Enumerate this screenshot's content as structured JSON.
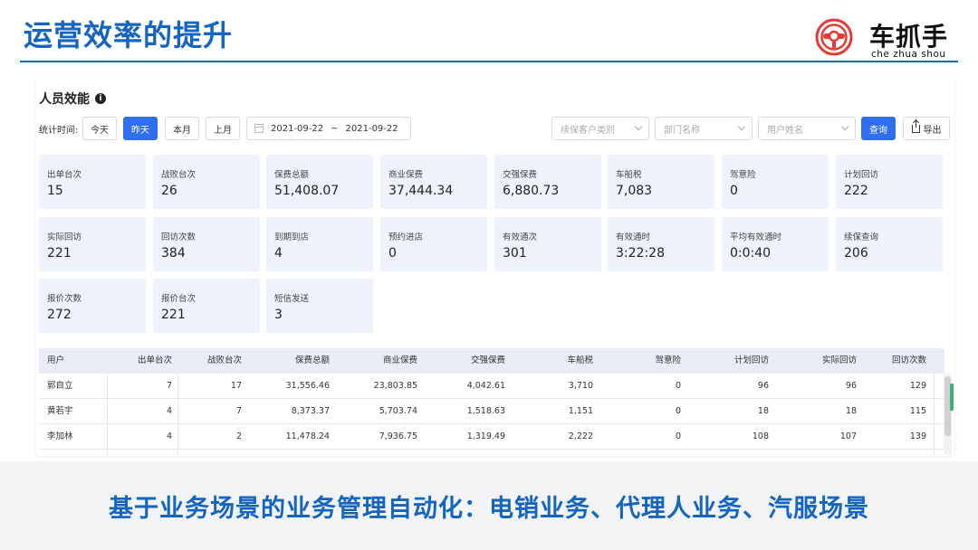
{
  "slide": {
    "title": "运营效率的提升",
    "footer": "基于业务场景的业务管理自动化：电销业务、代理人业务、汽服场景"
  },
  "logo": {
    "name_cn": "车抓手",
    "name_en": "che zhua shou",
    "brand_color": "#e53935"
  },
  "panel": {
    "title": "人员效能",
    "filters": {
      "stat_time_label": "统计时间:",
      "quick_ranges": [
        "今天",
        "昨天",
        "本月",
        "上月"
      ],
      "selected_range": "昨天",
      "date_start": "2021-09-22",
      "date_sep": "~",
      "date_end": "2021-09-22",
      "renewal_category_placeholder": "续保客户类别",
      "department_placeholder": "部门名称",
      "user_name_placeholder": "用户姓名",
      "query_label": "查询",
      "export_label": "导出"
    },
    "metrics": [
      {
        "label": "出单台次",
        "value": "15"
      },
      {
        "label": "战败台次",
        "value": "26"
      },
      {
        "label": "保费总额",
        "value": "51,408.07"
      },
      {
        "label": "商业保费",
        "value": "37,444.34"
      },
      {
        "label": "交强保费",
        "value": "6,880.73"
      },
      {
        "label": "车船税",
        "value": "7,083"
      },
      {
        "label": "驾意险",
        "value": "0"
      },
      {
        "label": "计划回访",
        "value": "222"
      },
      {
        "label": "实际回访",
        "value": "221"
      },
      {
        "label": "回访次数",
        "value": "384"
      },
      {
        "label": "到期到店",
        "value": "4"
      },
      {
        "label": "预约进店",
        "value": "0"
      },
      {
        "label": "有效通次",
        "value": "301"
      },
      {
        "label": "有效通时",
        "value": "3:22:28"
      },
      {
        "label": "平均有效通时",
        "value": "0:0:40"
      },
      {
        "label": "续保查询",
        "value": "206"
      },
      {
        "label": "报价次数",
        "value": "272"
      },
      {
        "label": "报价台次",
        "value": "221"
      },
      {
        "label": "短信发送",
        "value": "3"
      }
    ],
    "table": {
      "columns": [
        "用户",
        "出单台次",
        "战败台次",
        "保费总额",
        "商业保费",
        "交强保费",
        "车船税",
        "驾意险",
        "计划回访",
        "实际回访",
        "回访次数"
      ],
      "rows": [
        [
          "郭自立",
          "7",
          "17",
          "31,556.46",
          "23,803.85",
          "4,042.61",
          "3,710",
          "0",
          "96",
          "96",
          "129"
        ],
        [
          "黄若宇",
          "4",
          "7",
          "8,373.37",
          "5,703.74",
          "1,518.63",
          "1,151",
          "0",
          "18",
          "18",
          "115"
        ],
        [
          "李加林",
          "4",
          "2",
          "11,478.24",
          "7,936.75",
          "1,319.49",
          "2,222",
          "0",
          "108",
          "107",
          "139"
        ]
      ]
    }
  },
  "colors": {
    "title_blue": "#1565c0",
    "primary_button": "#2f6fed",
    "card_bg": "#eef3fb",
    "table_header_bg": "#e8edf5"
  }
}
